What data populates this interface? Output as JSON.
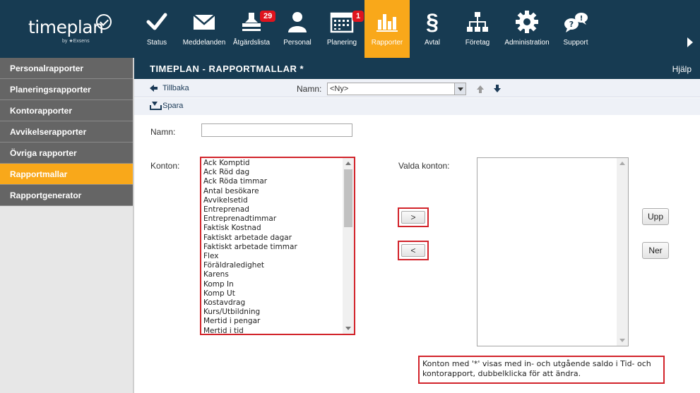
{
  "brand": {
    "name": "timeplan",
    "byline": "by ★Exsens"
  },
  "nav": {
    "items": [
      {
        "label": "Status",
        "icon": "checkmark-icon"
      },
      {
        "label": "Meddelanden",
        "icon": "envelope-icon"
      },
      {
        "label": "Åtgärdslista",
        "icon": "stamp-icon",
        "badge": "29"
      },
      {
        "label": "Personal",
        "icon": "person-icon"
      },
      {
        "label": "Planering",
        "icon": "calendar-icon",
        "badge": "1"
      },
      {
        "label": "Rapporter",
        "icon": "bar-chart-icon"
      },
      {
        "label": "Avtal",
        "icon": "paragraph-icon"
      },
      {
        "label": "Företag",
        "icon": "org-chart-icon"
      },
      {
        "label": "Administration",
        "icon": "gear-icon"
      },
      {
        "label": "Support",
        "icon": "chat-help-icon"
      }
    ],
    "active": "Rapporter",
    "active_color": "#f9a81a",
    "bar_color": "#173b52"
  },
  "sidebar": {
    "items": [
      {
        "label": "Personalrapporter"
      },
      {
        "label": "Planeringsrapporter"
      },
      {
        "label": "Kontorapporter"
      },
      {
        "label": "Avvikelserapporter"
      },
      {
        "label": "Övriga rapporter"
      },
      {
        "label": "Rapportmallar"
      },
      {
        "label": "Rapportgenerator"
      }
    ],
    "active": "Rapportmallar"
  },
  "page": {
    "title": "TIMEPLAN - RAPPORTMALLAR *",
    "help_label": "Hjälp"
  },
  "toolbar": {
    "back_label": "Tillbaka",
    "save_label": "Spara",
    "name_label": "Namn:",
    "name_select_value": "<Ny>"
  },
  "form": {
    "name_label": "Namn:",
    "name_value": "",
    "accounts_label": "Konton:",
    "selected_label": "Valda konton:",
    "accounts": [
      "Ack Komptid",
      "Ack Röd dag",
      "Ack Röda timmar",
      "Antal besökare",
      "Avvikelsetid",
      "Entreprenad",
      "Entreprenadtimmar",
      "Faktisk Kostnad",
      "Faktiskt arbetade dagar",
      "Faktiskt arbetade timmar",
      "Flex",
      "Föräldraledighet",
      "Karens",
      "Komp In",
      "Komp Ut",
      "Kostavdrag",
      "Kurs/Utbildning",
      "Mertid i pengar",
      "Mertid i tid"
    ],
    "selected_accounts": [],
    "add_label": ">",
    "remove_label": "<",
    "up_label": "Upp",
    "down_label": "Ner",
    "note": "Konton med '*' visas med in- och utgående saldo i Tid- och kontorapport, dubbelklicka för att ändra."
  },
  "highlight_color": "#d2232a"
}
